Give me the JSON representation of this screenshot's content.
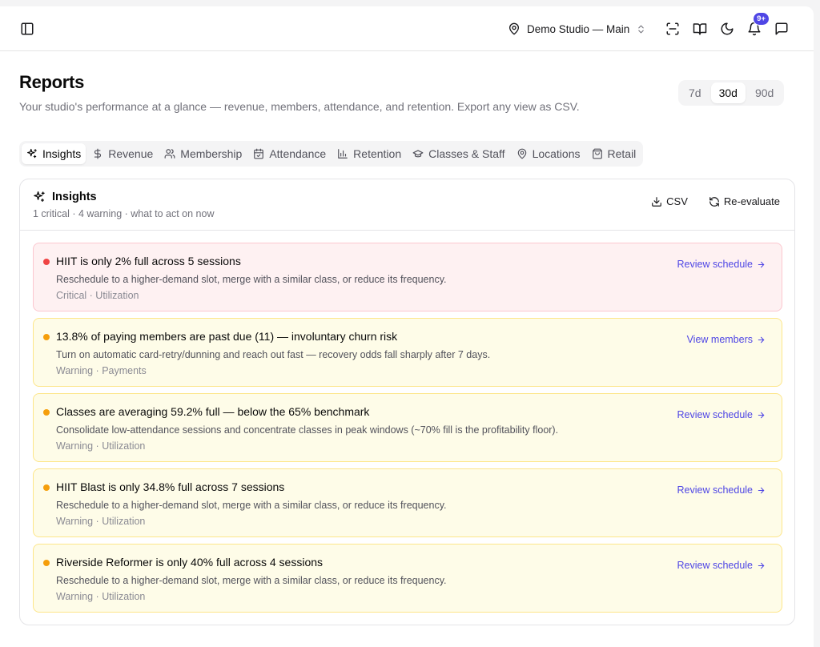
{
  "header": {
    "studio": "Demo Studio — Main",
    "notifications_badge": "9+"
  },
  "page": {
    "title": "Reports",
    "subtitle": "Your studio's performance at a glance — revenue, members, attendance, and retention. Export any view as CSV."
  },
  "range": {
    "options": [
      "7d",
      "30d",
      "90d"
    ],
    "selected": "30d"
  },
  "tabs": [
    {
      "label": "Insights",
      "icon": "sparkles-icon",
      "active": true
    },
    {
      "label": "Revenue",
      "icon": "dollar-icon"
    },
    {
      "label": "Membership",
      "icon": "users-icon"
    },
    {
      "label": "Attendance",
      "icon": "calendar-check-icon"
    },
    {
      "label": "Retention",
      "icon": "bar-chart-icon"
    },
    {
      "label": "Classes & Staff",
      "icon": "graduation-cap-icon"
    },
    {
      "label": "Locations",
      "icon": "map-pin-icon"
    },
    {
      "label": "Retail",
      "icon": "shopping-bag-icon"
    }
  ],
  "insights": {
    "title": "Insights",
    "summary": "1 critical · 4 warning · what to act on now",
    "csv_label": "CSV",
    "reevaluate_label": "Re-evaluate",
    "items": [
      {
        "severity": "critical",
        "title": "HIIT is only 2% full across 5 sessions",
        "description": "Reschedule to a higher-demand slot, merge with a similar class, or reduce its frequency.",
        "meta": "Critical · Utilization",
        "action": "Review schedule"
      },
      {
        "severity": "warning",
        "title": "13.8% of paying members are past due (11) — involuntary churn risk",
        "description": "Turn on automatic card-retry/dunning and reach out fast — recovery odds fall sharply after 7 days.",
        "meta": "Warning · Payments",
        "action": "View members"
      },
      {
        "severity": "warning",
        "title": "Classes are averaging 59.2% full — below the 65% benchmark",
        "description": "Consolidate low-attendance sessions and concentrate classes in peak windows (~70% fill is the profitability floor).",
        "meta": "Warning · Utilization",
        "action": "Review schedule"
      },
      {
        "severity": "warning",
        "title": "HIIT Blast is only 34.8% full across 7 sessions",
        "description": "Reschedule to a higher-demand slot, merge with a similar class, or reduce its frequency.",
        "meta": "Warning · Utilization",
        "action": "Review schedule"
      },
      {
        "severity": "warning",
        "title": "Riverside Reformer is only 40% full across 4 sessions",
        "description": "Reschedule to a higher-demand slot, merge with a similar class, or reduce its frequency.",
        "meta": "Warning · Utilization",
        "action": "Review schedule"
      }
    ]
  },
  "colors": {
    "accent": "#4f46e5",
    "critical_dot": "#ef4444",
    "warning_dot": "#f59e0b",
    "critical_bg": "#fef1f2",
    "warning_bg": "#fefce8"
  }
}
